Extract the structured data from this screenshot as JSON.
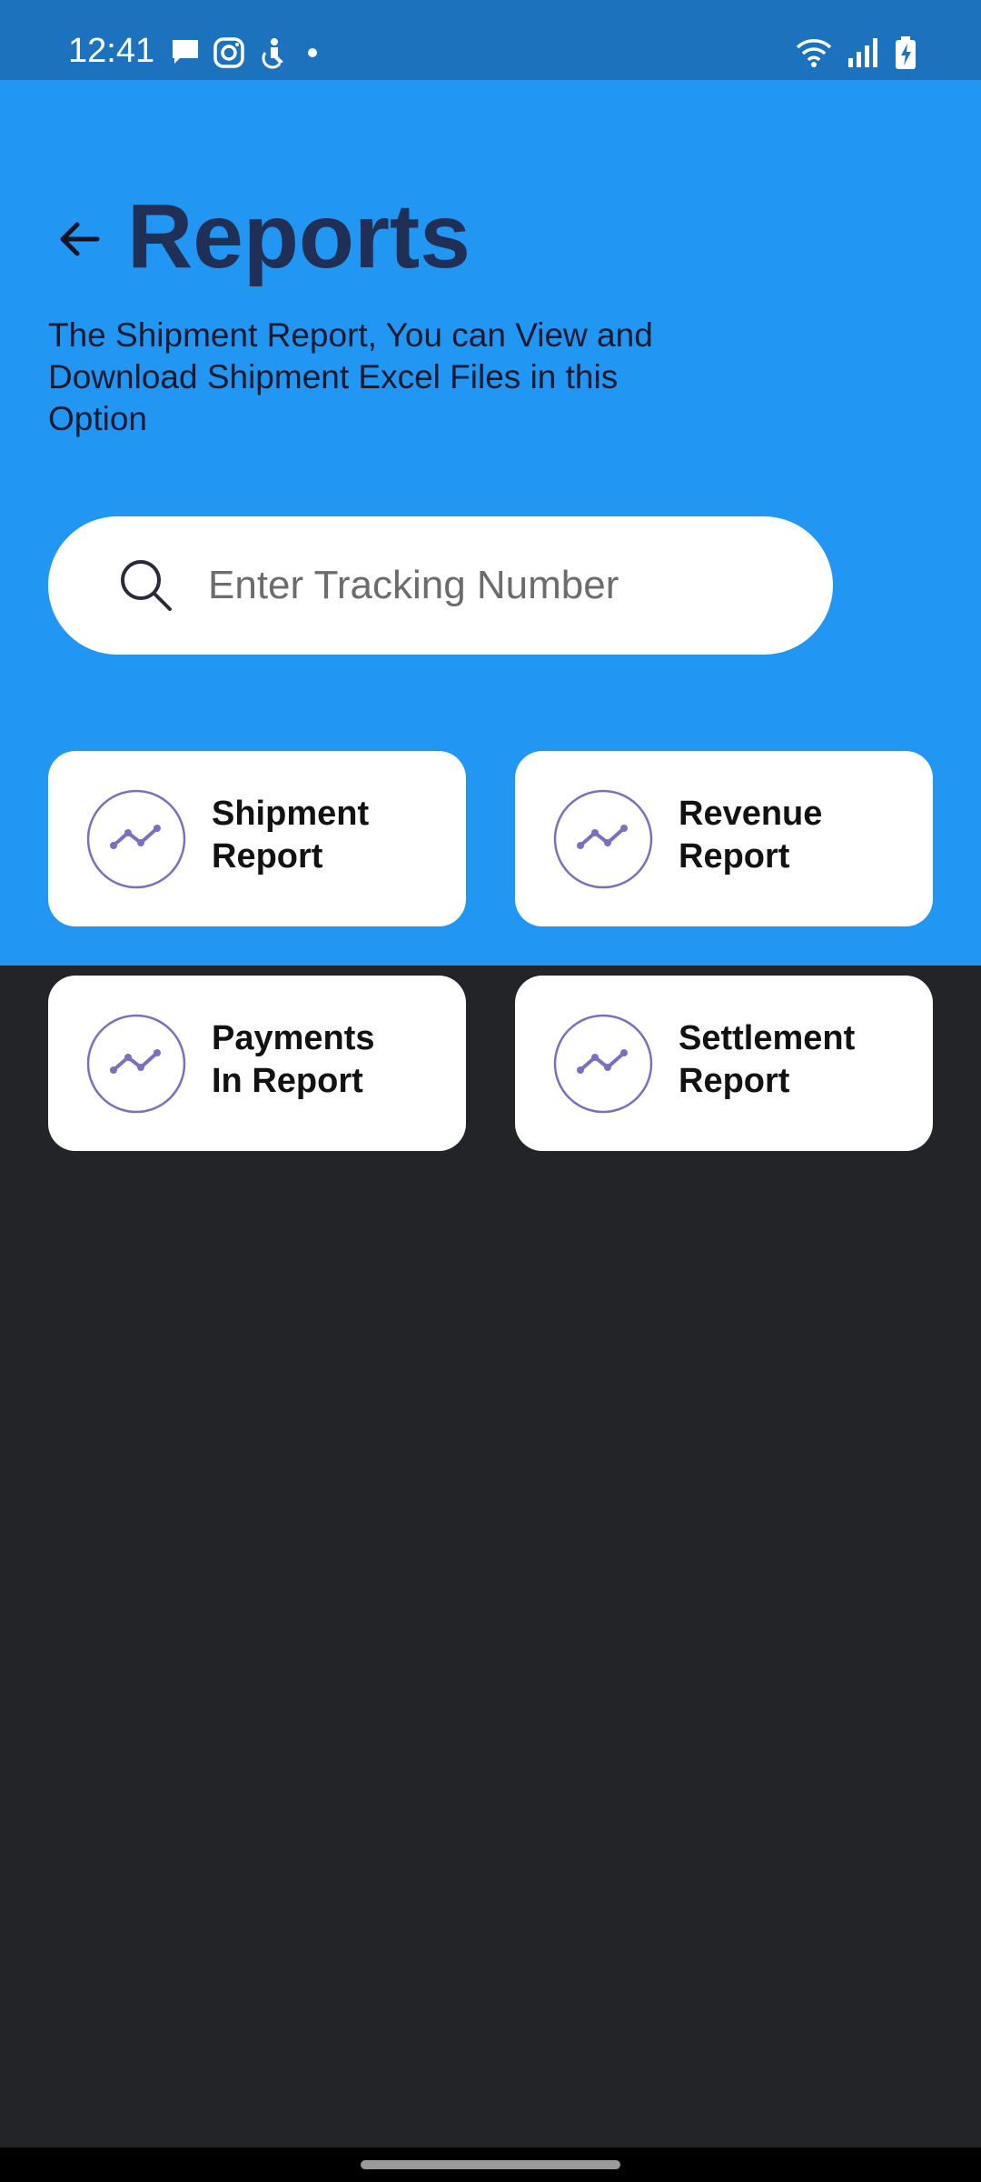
{
  "status_bar": {
    "time": "12:41",
    "left_icons": [
      "message-icon",
      "instagram-icon",
      "accessibility-icon",
      "dot-icon"
    ],
    "right_icons": [
      "wifi-icon",
      "signal-icon",
      "battery-charging-icon"
    ]
  },
  "header": {
    "title": "Reports",
    "description": "The Shipment Report, You can View and Download Shipment Excel Files in this Option",
    "background_color": "#2296f3",
    "title_color": "#1f2f55"
  },
  "search": {
    "placeholder": "Enter Tracking Number",
    "value": ""
  },
  "reports": [
    {
      "label": "Shipment\nReport",
      "icon": "trend-line-icon"
    },
    {
      "label": "Revenue\nReport",
      "icon": "trend-line-icon"
    },
    {
      "label": "Payments\nIn Report",
      "icon": "trend-line-icon"
    },
    {
      "label": "Settlement\nReport",
      "icon": "trend-line-icon"
    }
  ],
  "colors": {
    "accent": "#7c6fc0",
    "dark_background": "#232428",
    "status_bar": "#1d72be"
  }
}
